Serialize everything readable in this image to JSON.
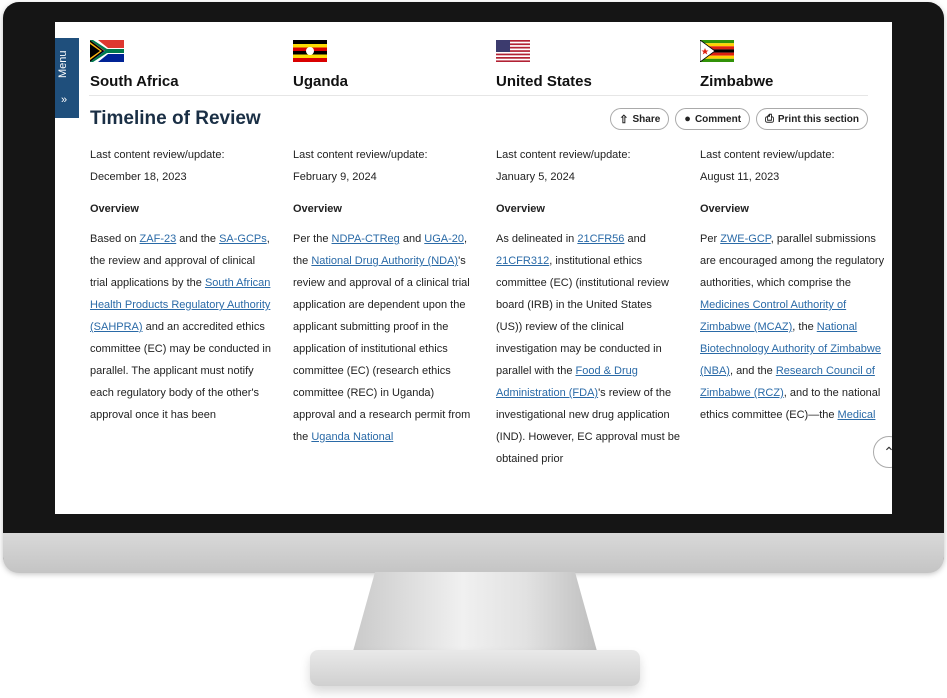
{
  "menu": {
    "label": "Menu",
    "arrow": "»"
  },
  "countries": [
    {
      "name": "South Africa",
      "flag": "south-africa-flag"
    },
    {
      "name": "Uganda",
      "flag": "uganda-flag"
    },
    {
      "name": "United States",
      "flag": "united-states-flag"
    },
    {
      "name": "Zimbabwe",
      "flag": "zimbabwe-flag"
    }
  ],
  "section_title": "Timeline of Review",
  "actions": {
    "share": "Share",
    "comment": "Comment",
    "print": "Print this section"
  },
  "columns": [
    {
      "review_label": "Last content review/update:",
      "review_date": "December 18, 2023",
      "overview": "Overview",
      "body": [
        {
          "t": "Based on "
        },
        {
          "t": "ZAF-23",
          "link": true
        },
        {
          "t": " and the "
        },
        {
          "t": "SA-GCPs",
          "link": true
        },
        {
          "t": ", the review and approval of clinical trial applications by the "
        },
        {
          "t": "South African Health Products Regulatory Authority (SAHPRA)",
          "link": true
        },
        {
          "t": " and an accredited ethics committee (EC) may be conducted in parallel. The applicant must notify each regulatory body of the other's approval once it has been"
        }
      ]
    },
    {
      "review_label": "Last content review/update:",
      "review_date": "February 9, 2024",
      "overview": "Overview",
      "body": [
        {
          "t": "Per the "
        },
        {
          "t": "NDPA-CTReg",
          "link": true
        },
        {
          "t": " and "
        },
        {
          "t": "UGA-20",
          "link": true
        },
        {
          "t": ", the "
        },
        {
          "t": "National Drug Authority (NDA)",
          "link": true
        },
        {
          "t": "'s review and approval of a clinical trial application are dependent upon the applicant submitting proof in the application of institutional ethics committee (EC) (research ethics committee (REC) in Uganda) approval and a research permit from the "
        },
        {
          "t": "Uganda National",
          "link": true
        }
      ]
    },
    {
      "review_label": "Last content review/update:",
      "review_date": "January 5, 2024",
      "overview": "Overview",
      "body": [
        {
          "t": "As delineated in "
        },
        {
          "t": "21CFR56",
          "link": true
        },
        {
          "t": " and "
        },
        {
          "t": "21CFR312",
          "link": true
        },
        {
          "t": ", institutional ethics committee (EC) (institutional review board (IRB) in the United States (US)) review of the clinical investigation may be conducted in parallel with the "
        },
        {
          "t": "Food & Drug Administration (FDA)",
          "link": true
        },
        {
          "t": "'s review of the investigational new drug application (IND). However, EC approval must be obtained prior"
        }
      ]
    },
    {
      "review_label": "Last content review/update:",
      "review_date": "August 11, 2023",
      "overview": "Overview",
      "body": [
        {
          "t": "Per "
        },
        {
          "t": "ZWE-GCP",
          "link": true
        },
        {
          "t": ", parallel submissions are encouraged among the regulatory authorities, which comprise the "
        },
        {
          "t": "Medicines Control Authority of Zimbabwe (MCAZ)",
          "link": true
        },
        {
          "t": ", the "
        },
        {
          "t": "National Biotechnology Authority of Zimbabwe (NBA)",
          "link": true
        },
        {
          "t": ", and the "
        },
        {
          "t": "Research Council of Zimbabwe (RCZ)",
          "link": true
        },
        {
          "t": ", and to the national ethics committee (EC)—the "
        },
        {
          "t": "Medical",
          "link": true
        }
      ]
    }
  ],
  "scroll_top_icon": "chevron-up-icon"
}
